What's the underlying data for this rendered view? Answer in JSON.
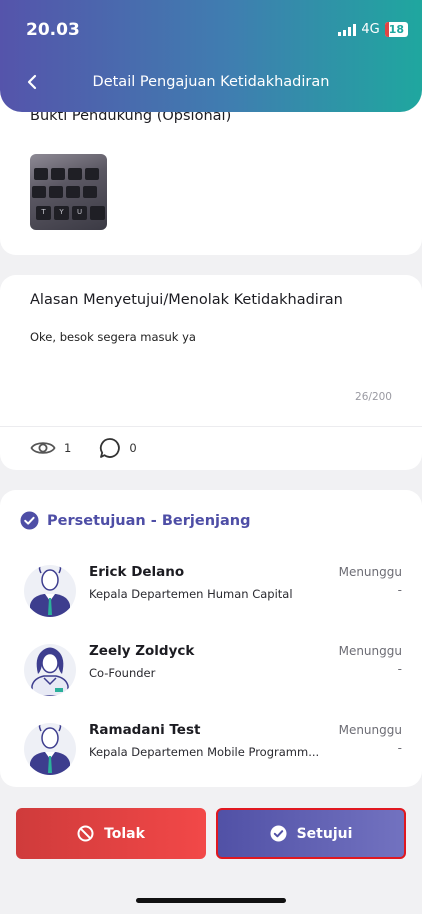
{
  "status_bar": {
    "time": "20.03",
    "network": "4G",
    "battery": "18"
  },
  "header": {
    "title": "Detail Pengajuan Ketidakhadiran",
    "back_icon": "chevron-left-icon"
  },
  "evidence": {
    "label": "Bukti Pendukung (Opsional)",
    "thumbnail_keys": [
      "T",
      "Y",
      "U"
    ]
  },
  "reason": {
    "title": "Alasan Menyetujui/Menolak Ketidakhadiran",
    "text": "Oke, besok segera masuk ya",
    "counter": "26/200",
    "views": "1",
    "comments": "0"
  },
  "approval": {
    "title": "Persetujuan - Berjenjang",
    "approvers": [
      {
        "name": "Erick Delano",
        "role": "Kepala Departemen Human Capital",
        "status": "Menunggu",
        "date": "-",
        "avatar": "male-avatar"
      },
      {
        "name": "Zeely Zoldyck",
        "role": "Co-Founder",
        "status": "Menunggu",
        "date": "-",
        "avatar": "female-avatar"
      },
      {
        "name": "Ramadani Test",
        "role": "Kepala Departemen Mobile Programm...",
        "status": "Menunggu",
        "date": "-",
        "avatar": "male-avatar"
      }
    ]
  },
  "actions": {
    "reject_label": "Tolak",
    "approve_label": "Setujui"
  },
  "colors": {
    "primary": "#5151a6",
    "danger": "#e04545",
    "header_start": "#5554ab",
    "header_end": "#1fa79f"
  }
}
